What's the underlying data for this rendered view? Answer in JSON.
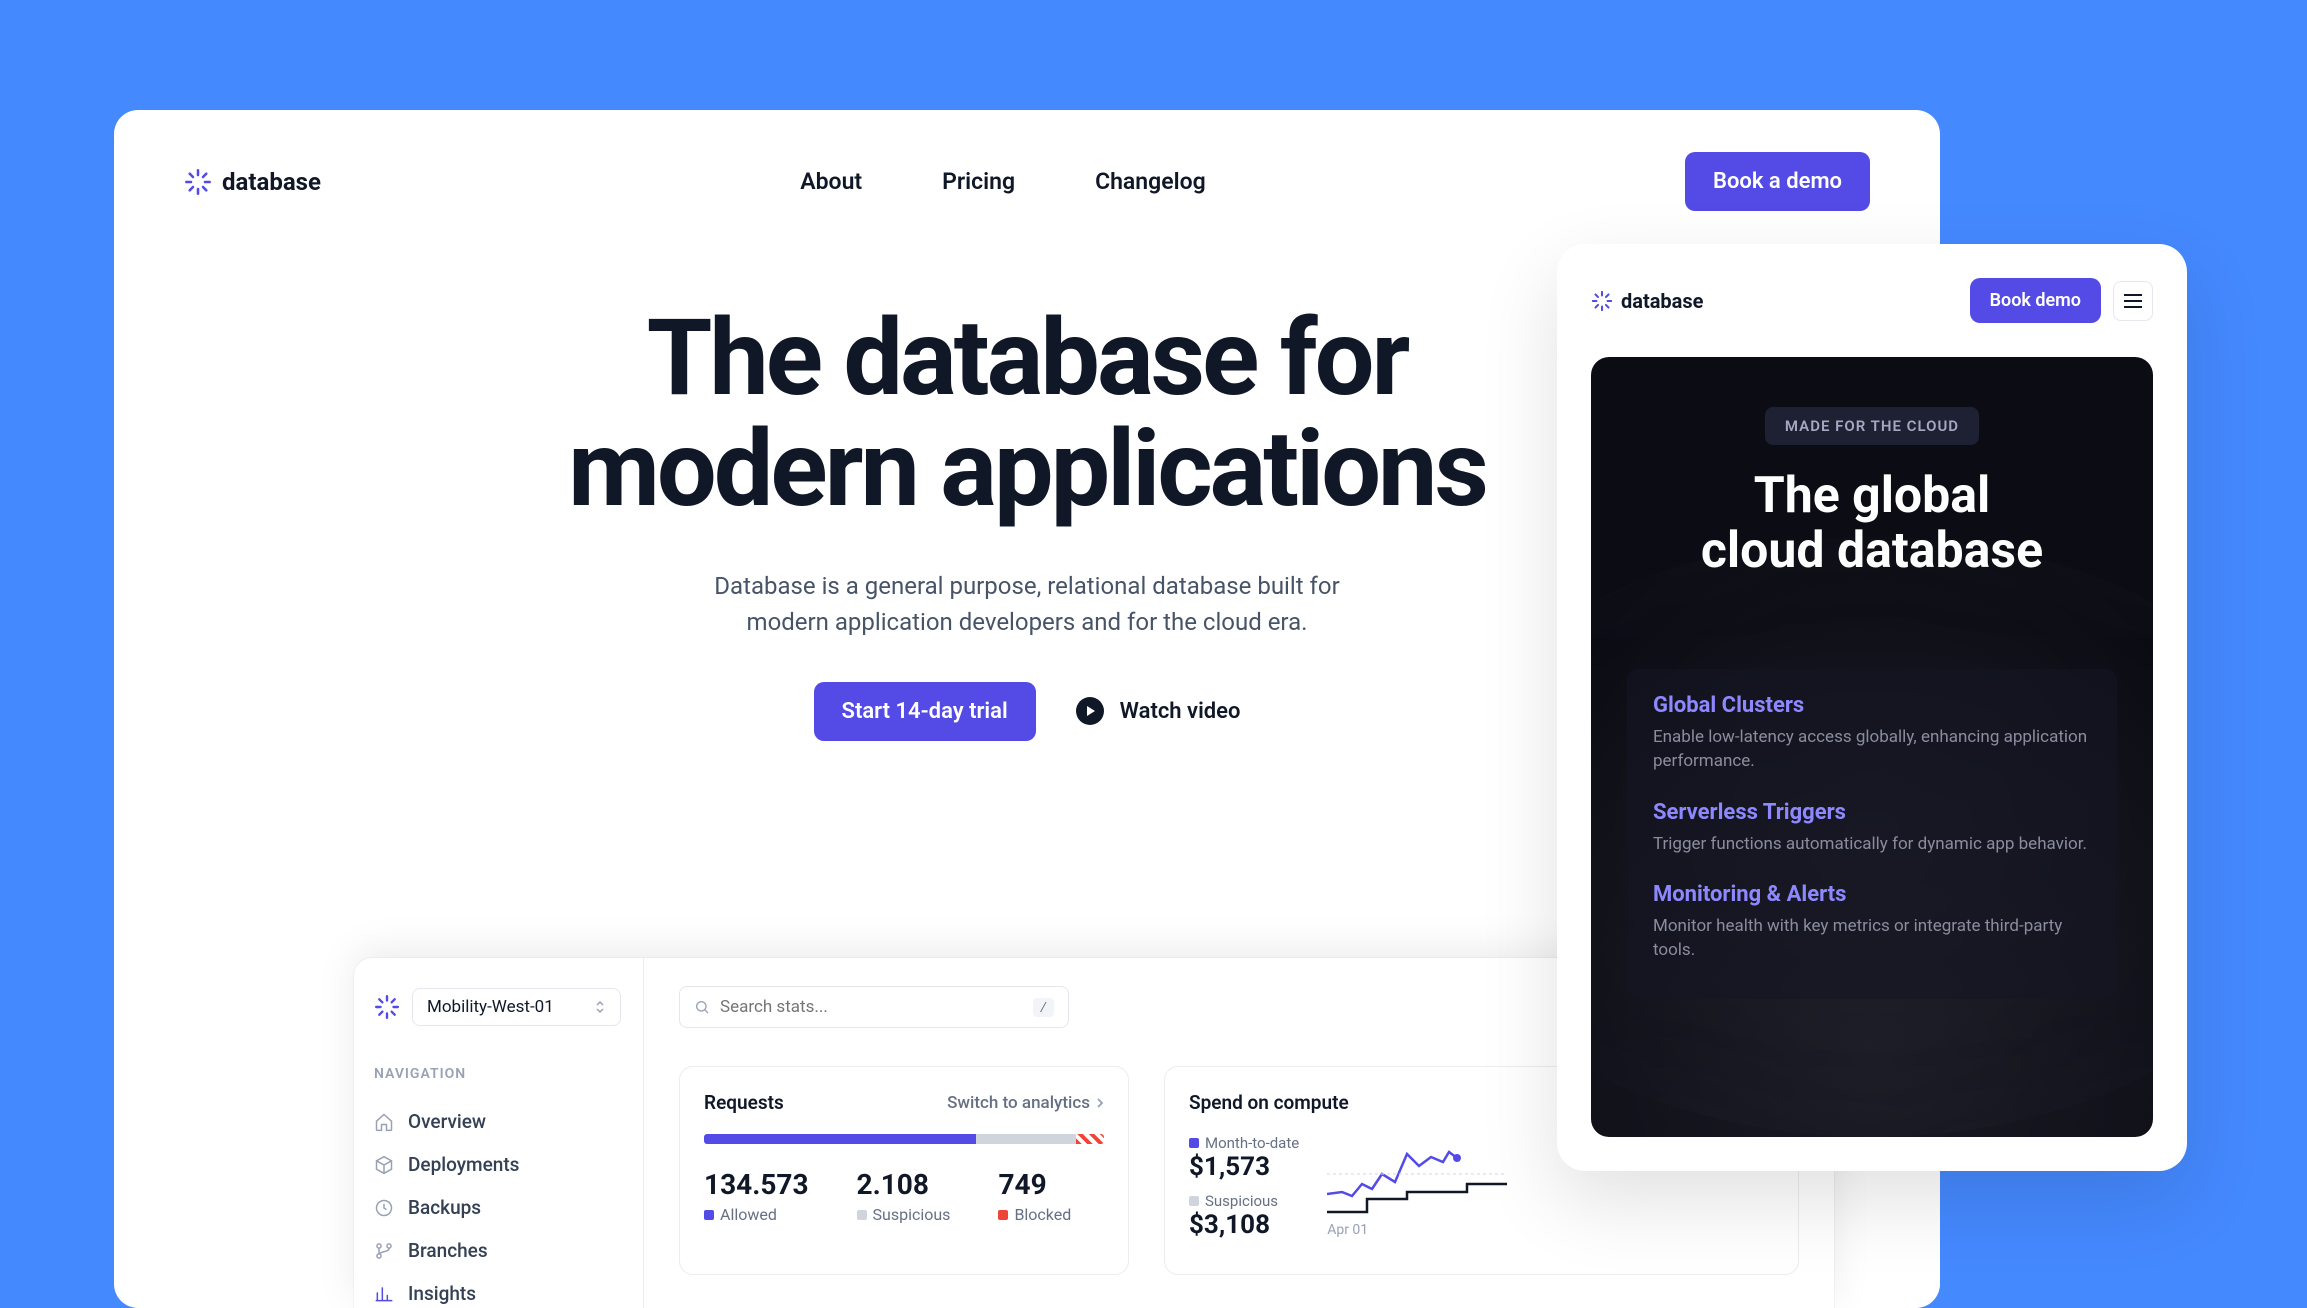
{
  "header": {
    "logo_text": "database",
    "nav": [
      "About",
      "Pricing",
      "Changelog"
    ],
    "cta": "Book a demo"
  },
  "hero": {
    "title_line1": "The database for",
    "title_line2": "modern applications",
    "subtitle_line1": "Database is a general purpose, relational database built for",
    "subtitle_line2": "modern application developers and for the cloud era.",
    "primary_btn": "Start 14-day trial",
    "secondary_btn": "Watch video"
  },
  "dashboard": {
    "project": "Mobility-West-01",
    "search_placeholder": "Search stats...",
    "shortcut": "/",
    "nav_label": "NAVIGATION",
    "nav_items": [
      {
        "icon": "home",
        "label": "Overview"
      },
      {
        "icon": "cube",
        "label": "Deployments"
      },
      {
        "icon": "clock",
        "label": "Backups"
      },
      {
        "icon": "branch",
        "label": "Branches"
      },
      {
        "icon": "chart",
        "label": "Insights"
      }
    ],
    "requests_card": {
      "title": "Requests",
      "link": "Switch to analytics",
      "metrics": [
        {
          "value": "134.573",
          "label": "Allowed",
          "dot": "dot-blue"
        },
        {
          "value": "2.108",
          "label": "Suspicious",
          "dot": "dot-gray"
        },
        {
          "value": "749",
          "label": "Blocked",
          "dot": "dot-red"
        }
      ]
    },
    "spend_card": {
      "title": "Spend on compute",
      "items": [
        {
          "label": "Month-to-date",
          "value": "$1,573",
          "dot": "dot-blue"
        },
        {
          "label": "Suspicious",
          "value": "$3,108",
          "dot": "dot-gray"
        }
      ],
      "chart_date": "Apr 01"
    }
  },
  "mobile": {
    "logo_text": "database",
    "cta": "Book demo",
    "badge": "MADE FOR THE CLOUD",
    "title_line1": "The global",
    "title_line2": "cloud database",
    "features": [
      {
        "title": "Global Clusters",
        "desc": "Enable low-latency access globally, enhancing application performance."
      },
      {
        "title": "Serverless Triggers",
        "desc": "Trigger functions automatically for dynamic app behavior."
      },
      {
        "title": "Monitoring & Alerts",
        "desc": "Monitor health with key metrics or integrate third-party tools."
      }
    ]
  }
}
